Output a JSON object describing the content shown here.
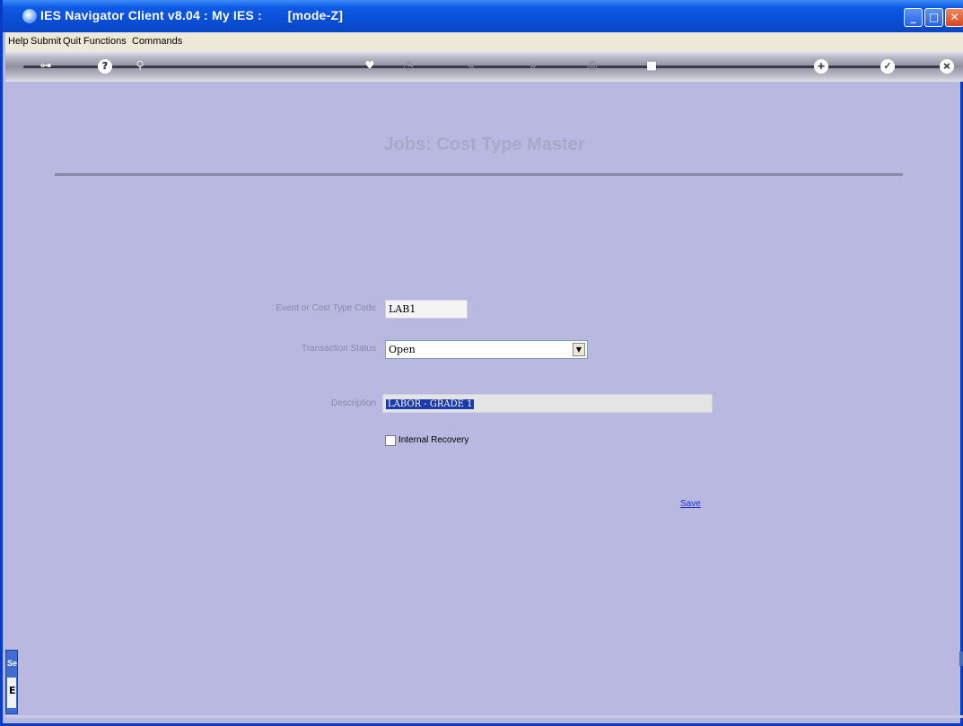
{
  "window": {
    "title": "IES Navigator Client v8.04 : My IES :       [mode-Z]",
    "min_label": "_",
    "max_label": "□",
    "close_label": "✕"
  },
  "menu": {
    "items": [
      "Help",
      "Submit",
      "Quit",
      "Functions",
      "Commands"
    ]
  },
  "toolbar": {
    "icons": [
      "key-icon",
      "help-icon",
      "search-icon",
      "favorite-heart-icon",
      "clock-icon",
      "previous-icon",
      "next-icon",
      "print-icon",
      "stop-icon",
      "add-icon",
      "confirm-icon",
      "close-icon"
    ]
  },
  "form": {
    "heading": "Jobs: Cost Type Master",
    "code_label": "Event or Cost Type Code",
    "code_value": "LAB1",
    "status_label": "Transaction Status",
    "status_value": "Open",
    "description_label": "Description",
    "description_value": "LABOR - GRADE 1",
    "internal_recovery_label": "Internal Recovery",
    "internal_recovery_checked": false,
    "save_label": "Save"
  },
  "side_tab": {
    "label": "Se",
    "char": "E"
  },
  "colors": {
    "title_bar": "#0a4fd6",
    "background": "#b8b8e0",
    "link": "#1c2fd6"
  }
}
